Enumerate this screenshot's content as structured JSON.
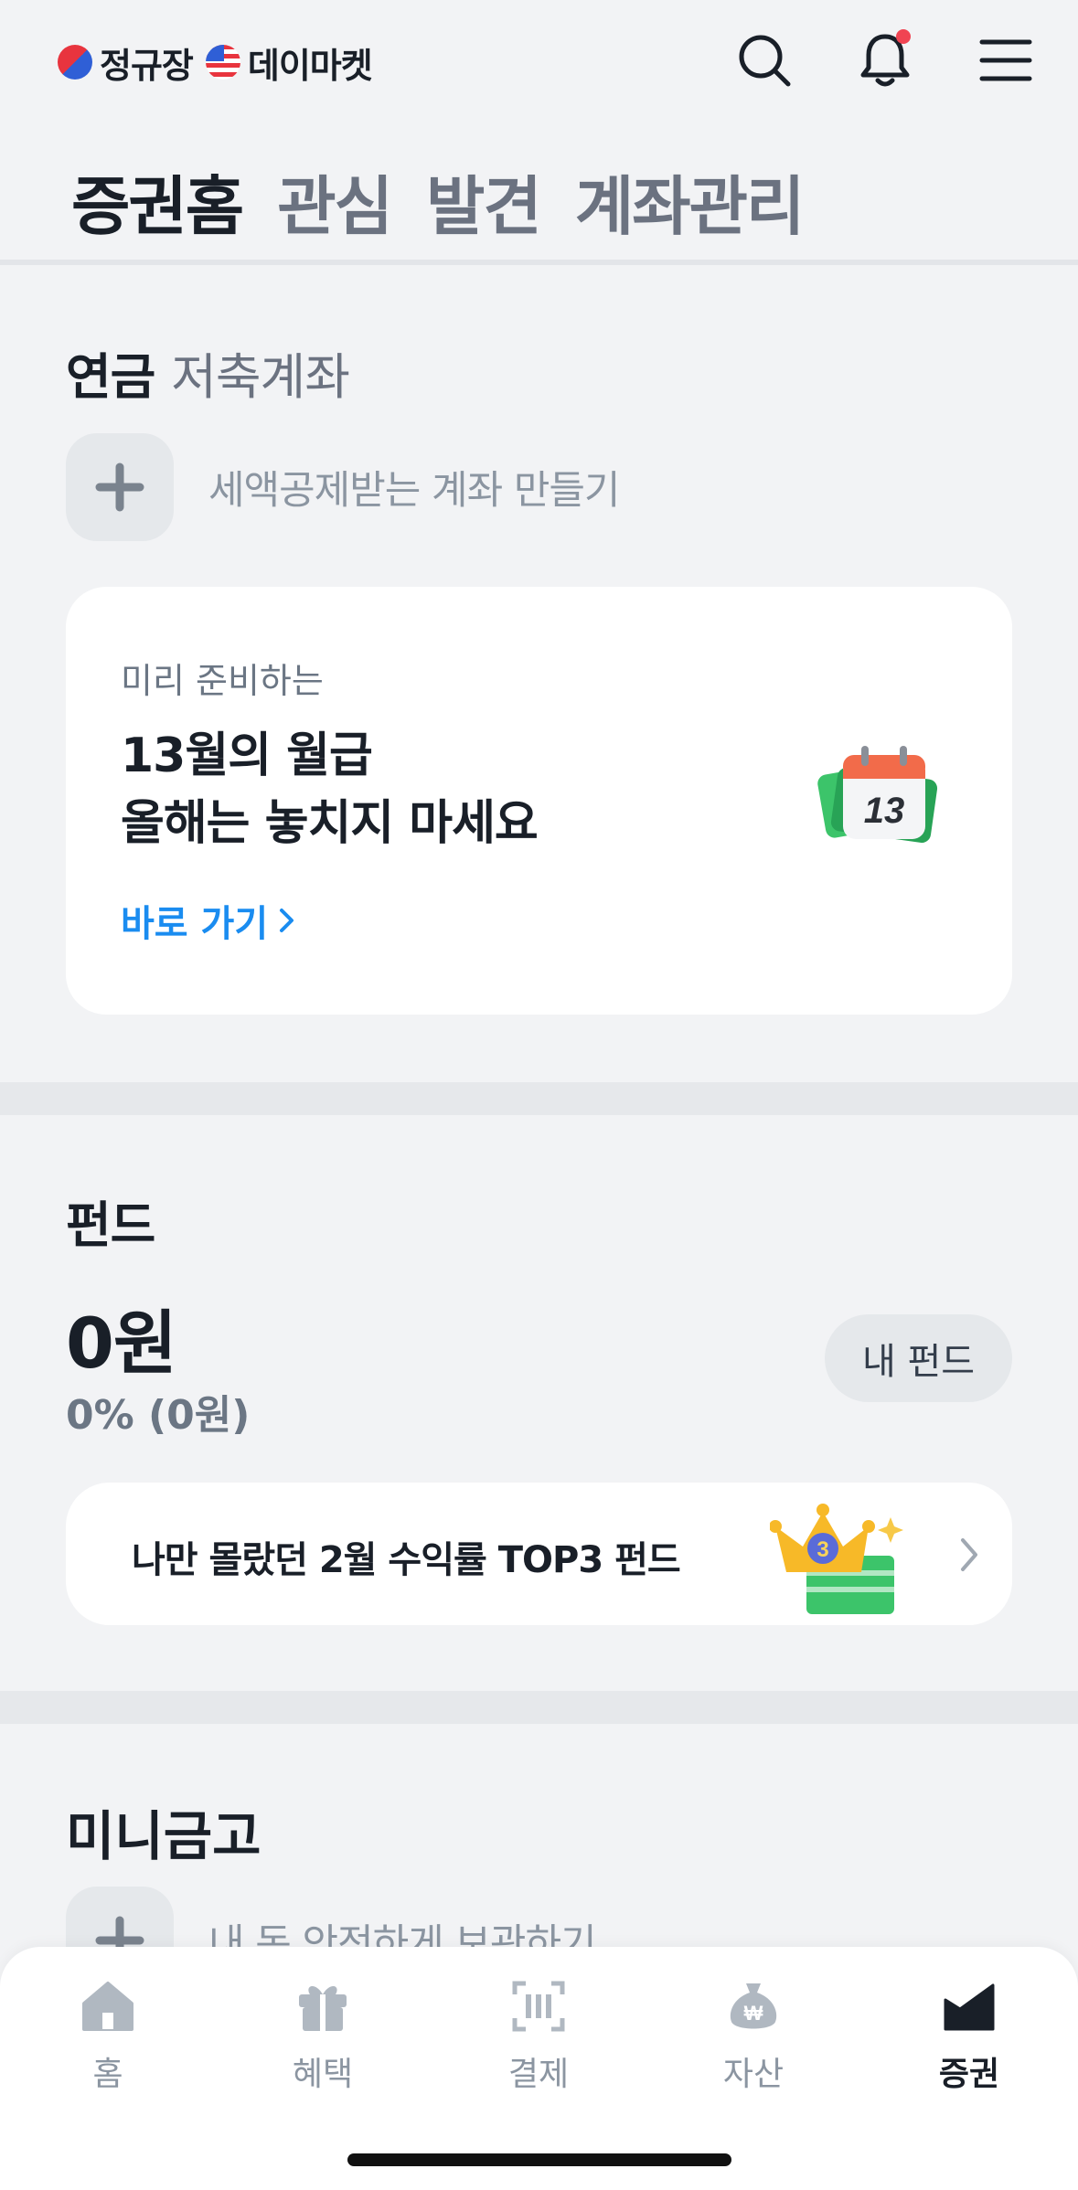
{
  "header": {
    "brand_kr": "정규장",
    "brand_us": "데이마켓",
    "icons": [
      "search-icon",
      "bell-icon",
      "menu-icon"
    ],
    "has_notification": true
  },
  "tabs": [
    {
      "label": "증권홈",
      "active": true
    },
    {
      "label": "관심",
      "active": false
    },
    {
      "label": "발견",
      "active": false
    },
    {
      "label": "계좌관리",
      "active": false
    }
  ],
  "pension": {
    "title": "연금",
    "subtitle": "저축계좌",
    "add_label": "세액공제받는 계좌 만들기",
    "promo": {
      "pre": "미리 준비하는",
      "line1": "13월의 월급",
      "line2": "올해는 놓치지 마세요",
      "link": "바로 가기",
      "calendar_number": "13"
    }
  },
  "fund": {
    "title": "펀드",
    "amount": "0원",
    "rate": "0% (0원)",
    "my_fund_button": "내 펀드",
    "top3_text": "나만 몰랐던 2월 수익률 TOP3 펀드",
    "crown_number": "3"
  },
  "mini": {
    "title": "미니금고",
    "add_label": "내 돈 안전하게 보관하기"
  },
  "nav": [
    {
      "label": "홈",
      "icon": "home-icon",
      "active": false
    },
    {
      "label": "혜택",
      "icon": "gift-icon",
      "active": false
    },
    {
      "label": "결제",
      "icon": "barcode-icon",
      "active": false
    },
    {
      "label": "자산",
      "icon": "money-bag-icon",
      "active": false
    },
    {
      "label": "증권",
      "icon": "chart-icon",
      "active": true
    }
  ],
  "colors": {
    "background": "#f2f3f5",
    "accent_blue": "#1a8cf0",
    "notification_red": "#f04452",
    "text_primary": "#191f28",
    "text_secondary": "#6b7684"
  }
}
